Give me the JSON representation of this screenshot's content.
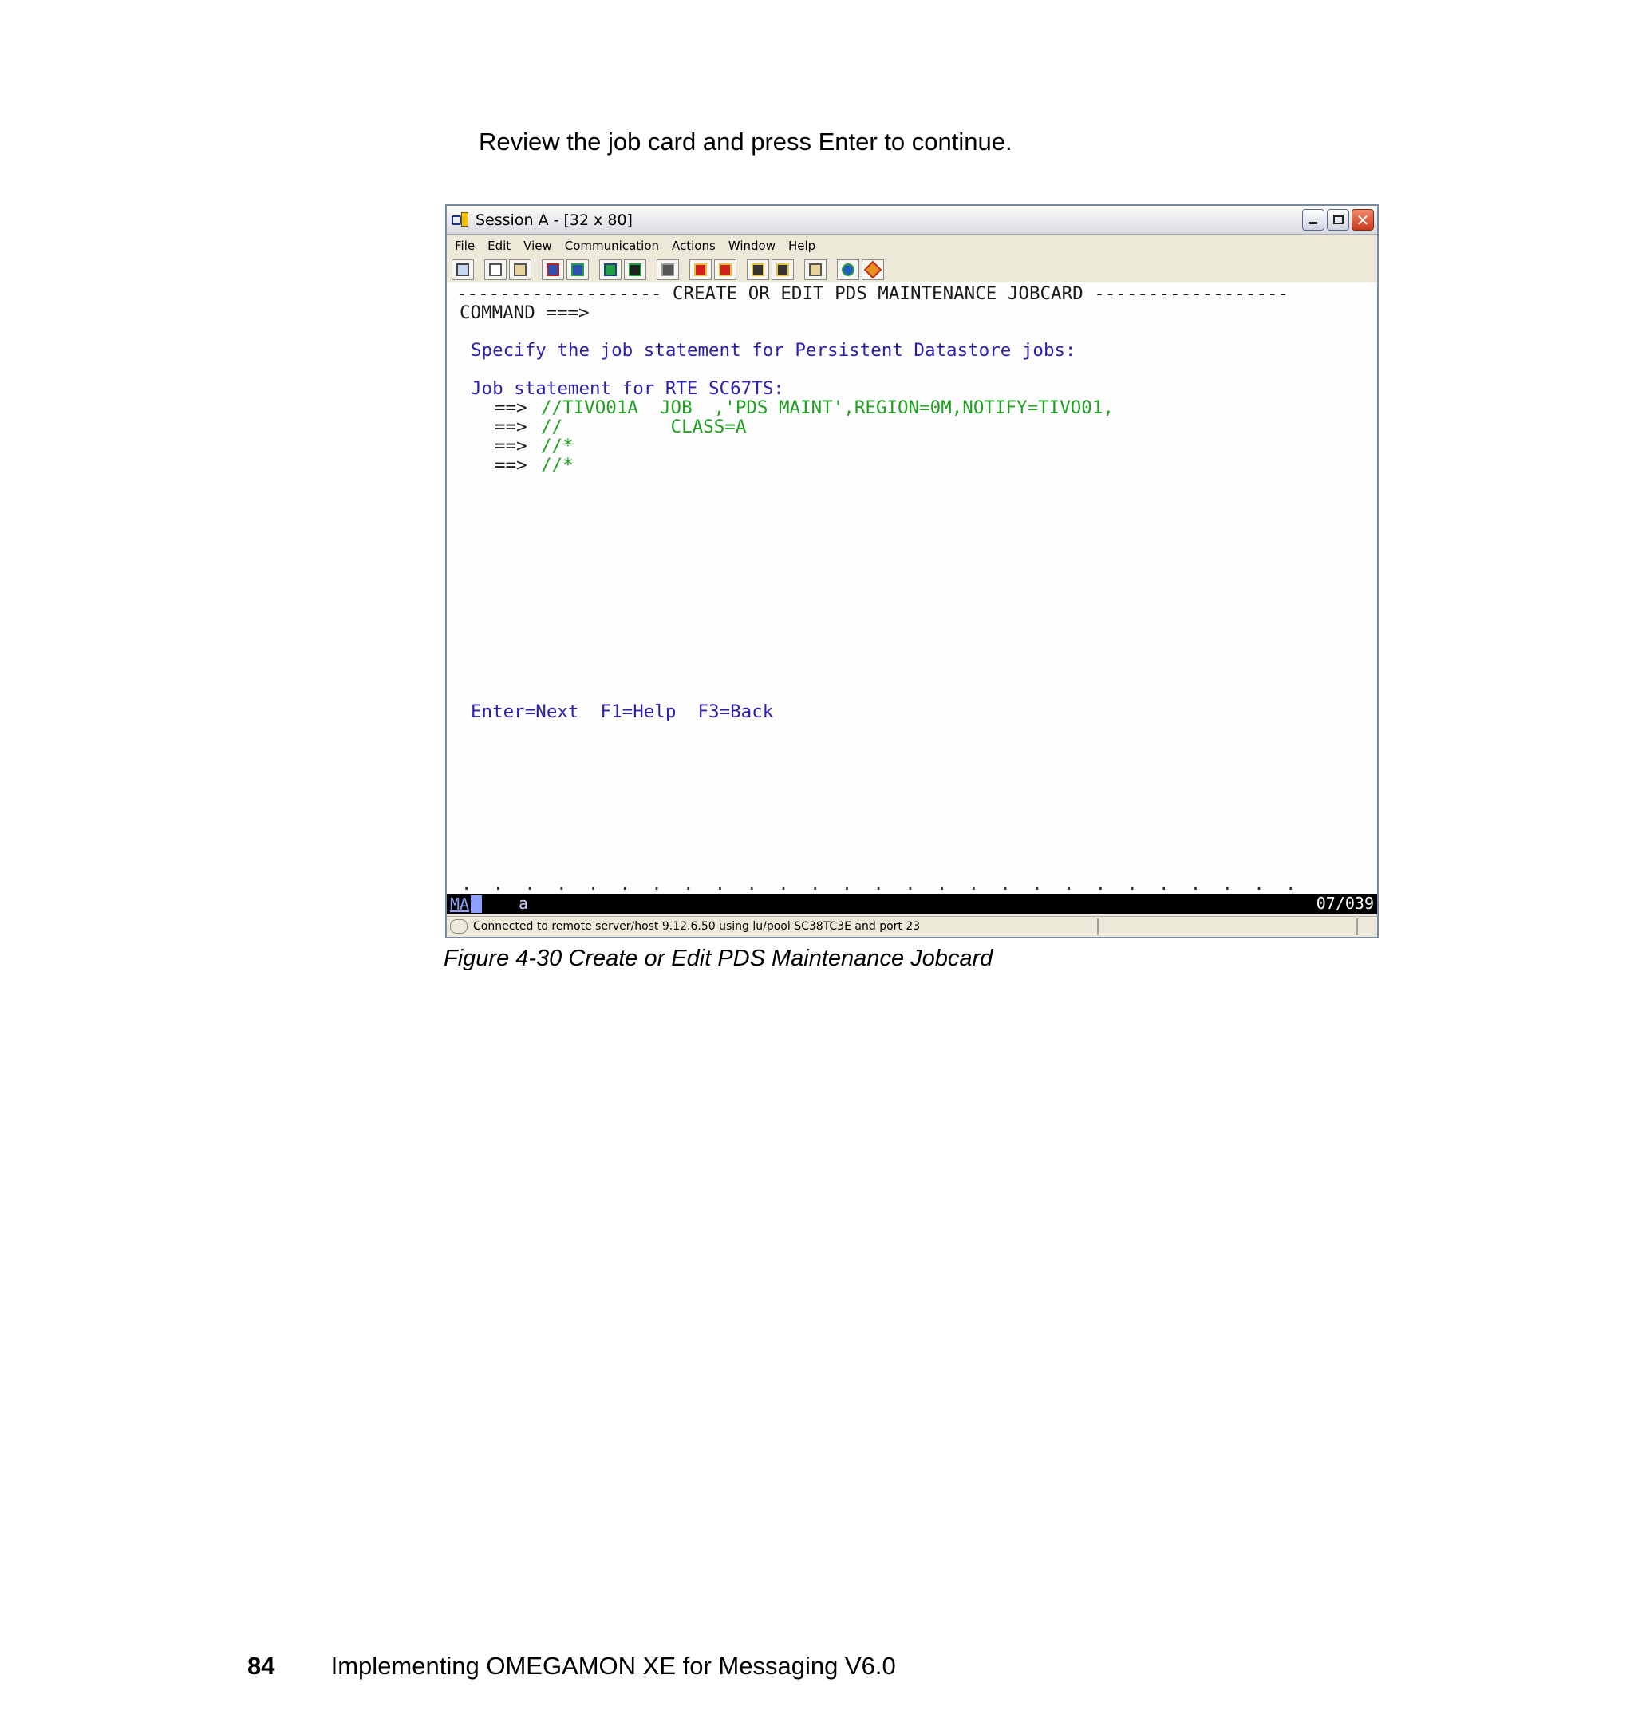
{
  "intro_text": "Review the job card and press Enter to continue.",
  "window": {
    "title": "Session A - [32 x 80]",
    "menu": [
      "File",
      "Edit",
      "View",
      "Communication",
      "Actions",
      "Window",
      "Help"
    ]
  },
  "toolbar_icons": [
    "print-screen-icon",
    "copy-icon",
    "paste-icon",
    "send-file-icon",
    "receive-file-icon",
    "display-setup-icon",
    "keyboard-map-icon",
    "macro-icon",
    "record-macro-icon",
    "stop-macro-icon",
    "play-macro-icon",
    "run-macro-icon",
    "clipboard-icon",
    "globe-icon",
    "edit-icon"
  ],
  "terminal": {
    "header_line": "------------------- CREATE OR EDIT PDS MAINTENANCE JOBCARD ------------------",
    "command_line": "COMMAND ===>",
    "instruction": "Specify the job statement for Persistent Datastore jobs:",
    "job_statement_label": "Job statement for RTE SC67TS:",
    "prompt": "==>",
    "job_lines": [
      "//TIVO01A  JOB  ,'PDS MAINT',REGION=0M,NOTIFY=TIVO01,",
      "//          CLASS=A",
      "//*",
      "//*"
    ],
    "pf_keys": "Enter=Next  F1=Help  F3=Back",
    "dots": ".  .  .  .  .  .  .  .  .  .  .  .  .  .  .  .  .  .  .  .  .  .  .  .  .  .  ."
  },
  "status": {
    "mode": "MA",
    "indicator": "a",
    "cursor_position": "07/039"
  },
  "connection_status": "Connected to remote server/host 9.12.6.50 using lu/pool SC38TC3E and port 23",
  "caption": "Figure 4-30   Create or Edit PDS Maintenance Jobcard",
  "footer": {
    "page_number": "84",
    "book_title": "Implementing OMEGAMON XE for Messaging V6.0"
  }
}
